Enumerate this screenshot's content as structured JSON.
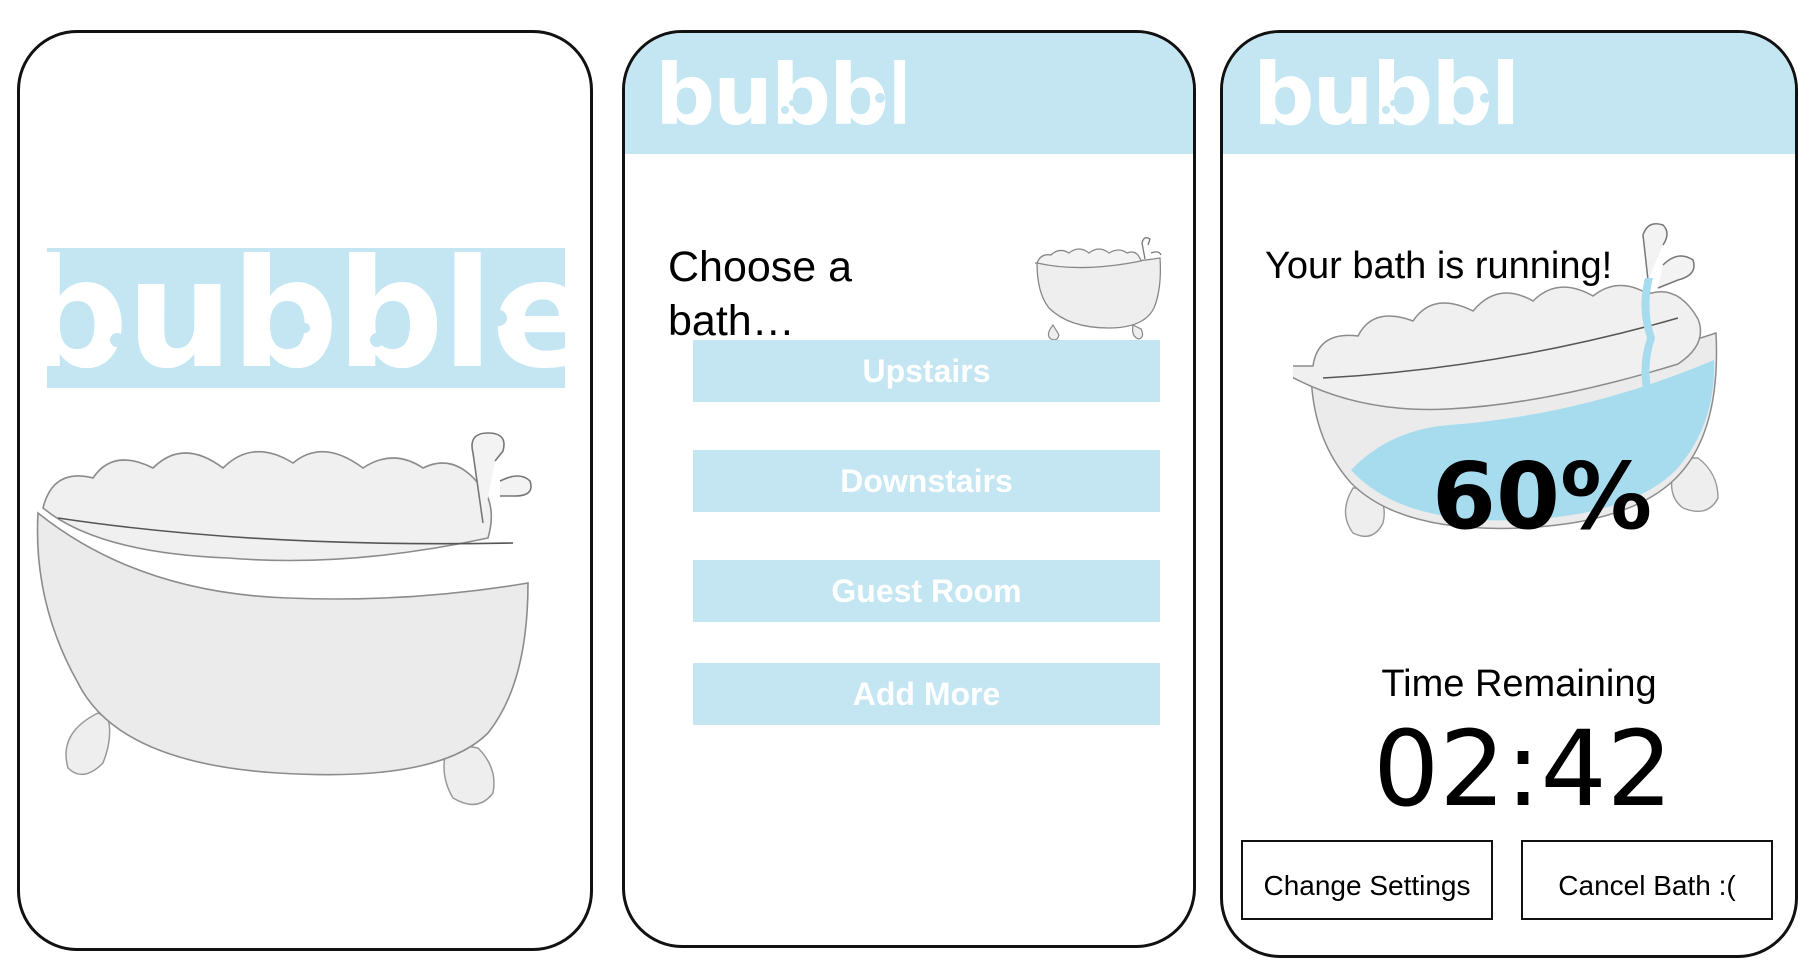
{
  "brand": {
    "logo_text": "bubble",
    "accent_color": "#c3e6f2",
    "text_on_accent_color": "#ffffff",
    "illustration": "clawfoot-bathtub-icon"
  },
  "screens": {
    "splash": {
      "logo": "bubble"
    },
    "choose": {
      "logo": "bubble",
      "title": "Choose a bath…",
      "options": [
        {
          "label": "Upstairs"
        },
        {
          "label": "Downstairs"
        },
        {
          "label": "Guest Room"
        },
        {
          "label": "Add More"
        }
      ]
    },
    "running": {
      "logo": "bubble",
      "status": "Your bath is running!",
      "fill_percent_label": "60%",
      "fill_fraction": 0.6,
      "time_label": "Time Remaining",
      "time_value": "02:42",
      "buttons": {
        "change": "Change Settings",
        "cancel": "Cancel Bath :("
      }
    }
  }
}
